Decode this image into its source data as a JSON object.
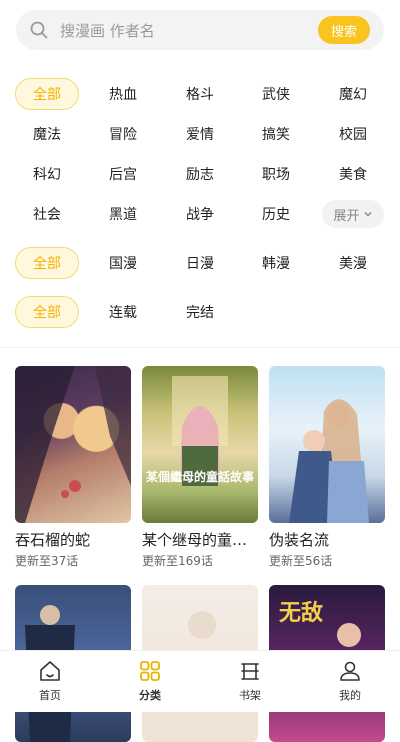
{
  "colors": {
    "accent": "#f9c320",
    "chip_active_bg": "#fff8dc",
    "chip_active_text": "#f2b300"
  },
  "search": {
    "placeholder": "搜漫画 作者名",
    "button_label": "搜索",
    "icon": "search-icon"
  },
  "filters": {
    "genre_rows": [
      [
        "全部",
        "热血",
        "格斗",
        "武侠",
        "魔幻"
      ],
      [
        "魔法",
        "冒险",
        "爱情",
        "搞笑",
        "校园"
      ],
      [
        "科幻",
        "后宫",
        "励志",
        "职场",
        "美食"
      ],
      [
        "社会",
        "黑道",
        "战争",
        "历史",
        "展开"
      ]
    ],
    "region": [
      "全部",
      "国漫",
      "日漫",
      "韩漫",
      "美漫"
    ],
    "status": [
      "全部",
      "连载",
      "完结"
    ],
    "active": [
      "全部",
      "全部",
      "全部"
    ]
  },
  "comics": [
    {
      "title": "吞石榴的蛇",
      "update": "更新至37话"
    },
    {
      "title": "某个继母的童…",
      "update": "更新至169话"
    },
    {
      "title": "伪装名流",
      "update": "更新至56话"
    },
    {
      "title": "",
      "update": ""
    },
    {
      "title": "",
      "update": ""
    },
    {
      "title": "",
      "update": ""
    }
  ],
  "cover_art_text": {
    "comic2": "某個繼母的童話故事",
    "comic6": "无敌"
  },
  "nav": {
    "items": [
      {
        "label": "首页",
        "icon": "home-icon"
      },
      {
        "label": "分类",
        "icon": "category-grid-icon",
        "active": true
      },
      {
        "label": "书架",
        "icon": "bookshelf-icon"
      },
      {
        "label": "我的",
        "icon": "user-icon"
      }
    ]
  }
}
